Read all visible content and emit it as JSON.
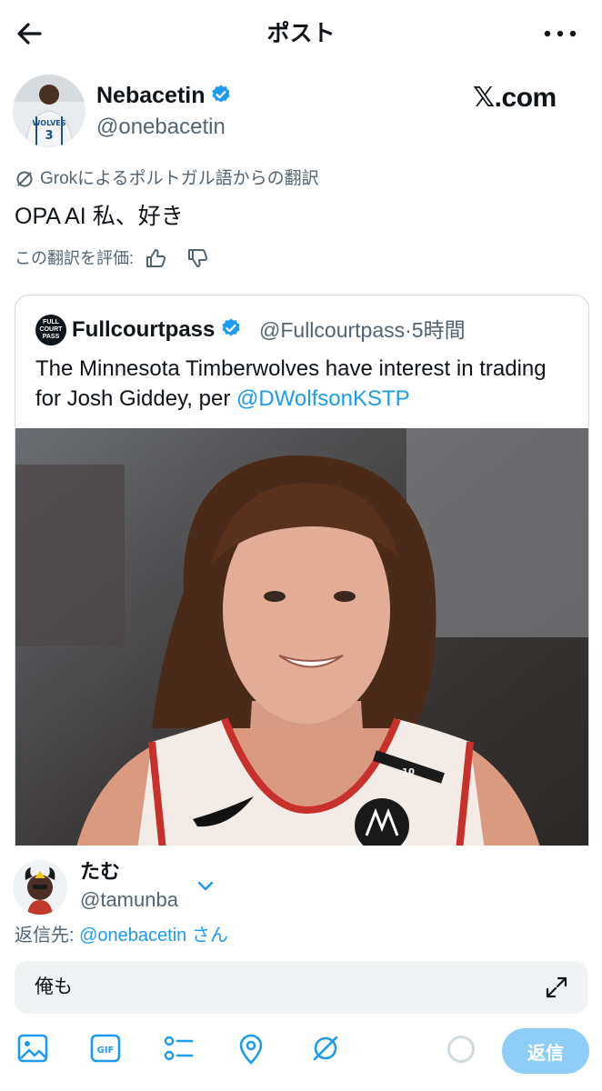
{
  "header": {
    "title": "ポスト"
  },
  "author": {
    "display_name": "Nebacetin",
    "handle": "@onebacetin",
    "watermark": "𝕏.com"
  },
  "translation": {
    "label": "Grokによるポルトガル語からの翻訳",
    "text": "OPA AI 私、好き",
    "rate_label": "この翻訳を評価:"
  },
  "quote": {
    "avatar_text": "FULL COURT PASS",
    "name": "Fullcourtpass",
    "handle": "@Fullcourtpass",
    "time": "5時間",
    "text": "The Minnesota Timberwolves have interest in trading for Josh Giddey, per ",
    "mention": "@DWolfsonKSTP",
    "jersey_number": "10"
  },
  "reply": {
    "name": "たむ",
    "handle": "@tamunba",
    "reply_to_prefix": "返信先: ",
    "reply_to_handle": "@onebacetin",
    "reply_to_suffix": " さん",
    "input_value": "俺も",
    "send_label": "返信"
  },
  "colors": {
    "link": "#1d9bf0",
    "muted": "#536471",
    "send_disabled": "#8ecdf8"
  }
}
